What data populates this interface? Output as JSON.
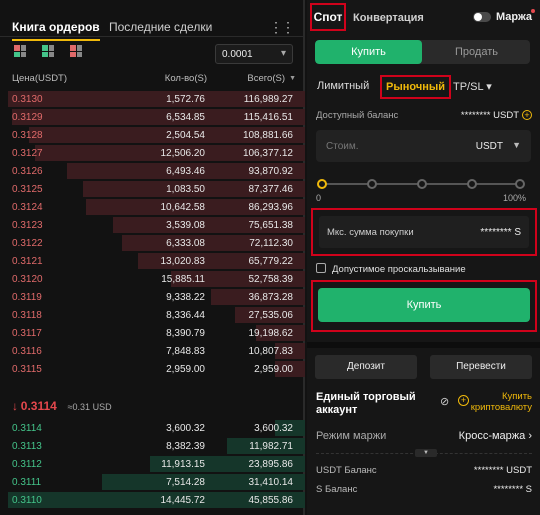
{
  "orderbook": {
    "tab_active": "Книга ордеров",
    "tab_inactive": "Последние сделки",
    "menu_dots": "⋮⋮",
    "precision": "0.0001",
    "col_price": "Цена(USDT)",
    "col_qty": "Кол-во(S)",
    "col_total": "Всего(S)",
    "asks": [
      {
        "price": "0.3130",
        "qty": "1,572.76",
        "total": "116,989.27"
      },
      {
        "price": "0.3129",
        "qty": "6,534.85",
        "total": "115,416.51"
      },
      {
        "price": "0.3128",
        "qty": "2,504.54",
        "total": "108,881.66"
      },
      {
        "price": "0.3127",
        "qty": "12,506.20",
        "total": "106,377.12"
      },
      {
        "price": "0.3126",
        "qty": "6,493.46",
        "total": "93,870.92"
      },
      {
        "price": "0.3125",
        "qty": "1,083.50",
        "total": "87,377.46"
      },
      {
        "price": "0.3124",
        "qty": "10,642.58",
        "total": "86,293.96"
      },
      {
        "price": "0.3123",
        "qty": "3,539.08",
        "total": "75,651.38"
      },
      {
        "price": "0.3122",
        "qty": "6,333.08",
        "total": "72,112.30"
      },
      {
        "price": "0.3121",
        "qty": "13,020.83",
        "total": "65,779.22"
      },
      {
        "price": "0.3120",
        "qty": "15,885.11",
        "total": "52,758.39"
      },
      {
        "price": "0.3119",
        "qty": "9,338.22",
        "total": "36,873.28"
      },
      {
        "price": "0.3118",
        "qty": "8,336.44",
        "total": "27,535.06"
      },
      {
        "price": "0.3117",
        "qty": "8,390.79",
        "total": "19,198.62"
      },
      {
        "price": "0.3116",
        "qty": "7,848.83",
        "total": "10,807.83"
      },
      {
        "price": "0.3115",
        "qty": "2,959.00",
        "total": "2,959.00"
      }
    ],
    "mid_arrow": "↓",
    "mid_price": "0.3114",
    "mid_usd": "≈0.31 USD",
    "bids": [
      {
        "price": "0.3114",
        "qty": "3,600.32",
        "total": "3,600.32"
      },
      {
        "price": "0.3113",
        "qty": "8,382.39",
        "total": "11,982.71"
      },
      {
        "price": "0.3112",
        "qty": "11,913.15",
        "total": "23,895.86"
      },
      {
        "price": "0.3111",
        "qty": "7,514.28",
        "total": "31,410.14"
      },
      {
        "price": "0.3110",
        "qty": "14,445.72",
        "total": "45,855.86"
      }
    ]
  },
  "trade": {
    "tab_spot": "Спот",
    "tab_convert": "Конвертация",
    "margin_label": "Маржа",
    "buy_tab": "Купить",
    "sell_tab": "Продать",
    "order_limit": "Лимитный",
    "order_market": "Рыночный",
    "order_tpsl": "TP/SL",
    "avail_label": "Доступный баланс",
    "avail_value": "******** USDT",
    "cost_placeholder": "Стоим.",
    "cost_currency": "USDT",
    "slider_min": "0",
    "slider_max": "100%",
    "max_buy_label": "Мкс. сумма покупки",
    "max_buy_value": "******** S",
    "slippage_label": "Допустимое проскальзывание",
    "buy_button": "Купить",
    "deposit": "Депозит",
    "transfer": "Перевести",
    "uta_title": "Единый торговый аккаунт",
    "buy_crypto": "Купить криптовалюту",
    "margin_mode_label": "Режим маржи",
    "margin_mode_value": "Кросс-маржа",
    "usdt_balance_label": "USDT Баланс",
    "usdt_balance_value": "******** USDT",
    "s_balance_label": "S Баланс",
    "s_balance_value": "******** S"
  },
  "colors": {
    "sell": "#e06a6a",
    "buy": "#44c48a",
    "accent": "#f0b90b",
    "buy_button": "#20b26c"
  }
}
